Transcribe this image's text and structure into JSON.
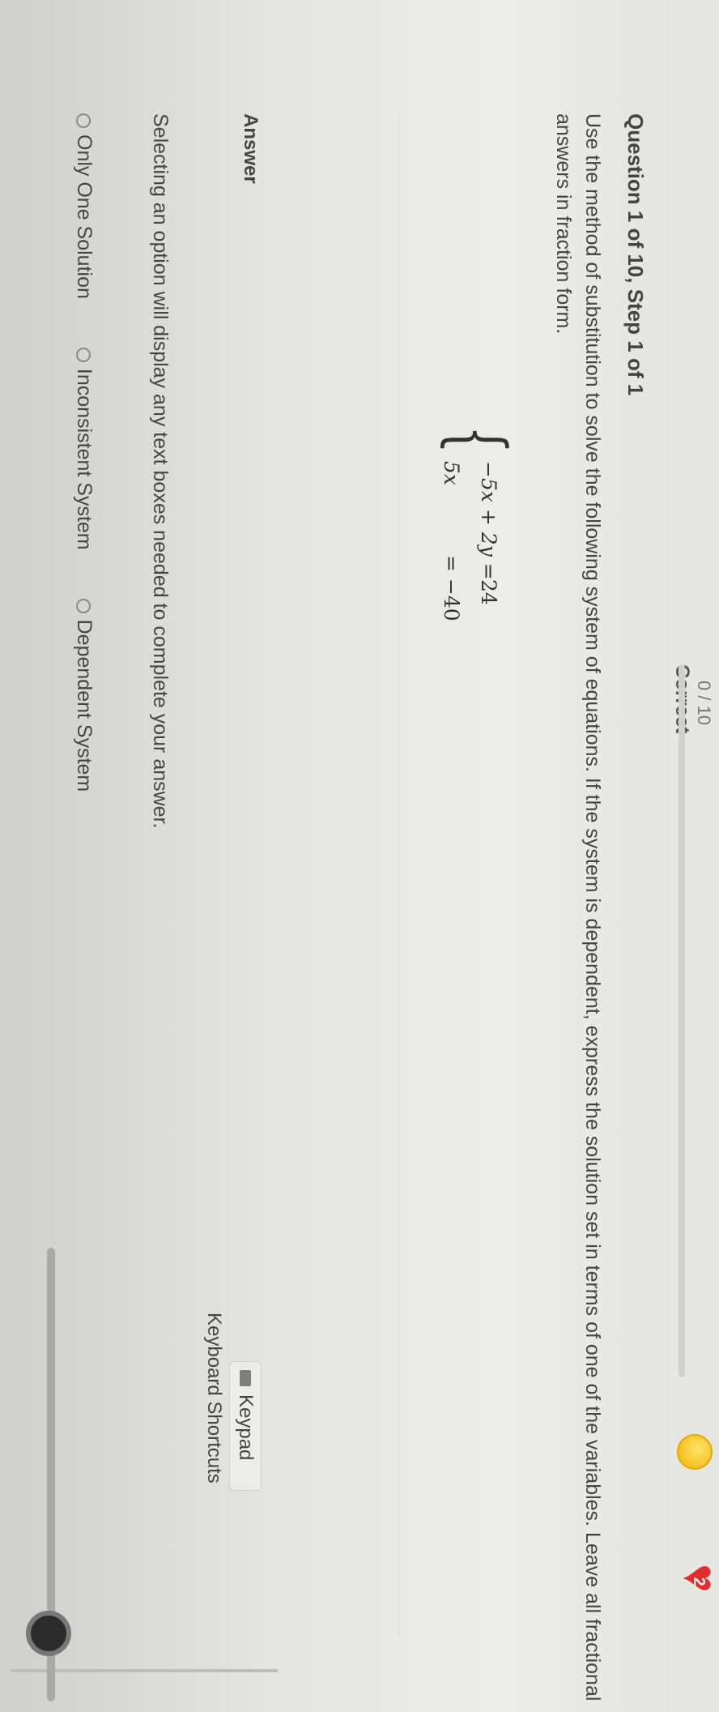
{
  "header": {
    "score": "0 / 10",
    "correct_label": "Correct",
    "lives": "2"
  },
  "question": {
    "heading": "Question 1 of 10, Step 1 of 1",
    "prompt": "Use the method of substitution to solve the following system of equations. If the system is dependent, express the solution set in terms of one of the variables. Leave all fractional answers in fraction form.",
    "equation1_lhs": "−5x + 2y =",
    "equation1_rhs": "24",
    "equation2_lhs": "5x",
    "equation2_rhs": "= −40"
  },
  "answer": {
    "label": "Answer",
    "keypad_label": "Keypad",
    "shortcuts_label": "Keyboard Shortcuts",
    "help_text": "Selecting an option will display any text boxes needed to complete your answer.",
    "options": [
      "Only One Solution",
      "Inconsistent System",
      "Dependent System"
    ]
  },
  "icons": {
    "coin": "coin-icon",
    "heart": "heart-icon",
    "keypad": "keypad-icon",
    "radio": "radio-icon"
  },
  "colors": {
    "heart": "#e32d2d",
    "coin": "#f2b400",
    "edge_green": "#8cc68a"
  }
}
